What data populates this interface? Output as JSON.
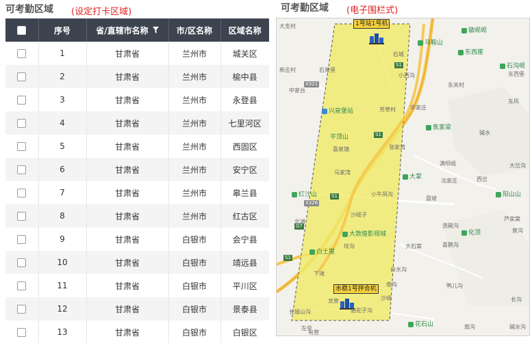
{
  "left_panel": {
    "title": "可考勤区域",
    "note": "(设定打卡区域)",
    "columns": {
      "index": "序号",
      "province": "省/直辖市名称",
      "city": "市/区名称",
      "region": "区域名称"
    },
    "rows": [
      {
        "index": "1",
        "province": "甘肃省",
        "city": "兰州市",
        "region": "城关区"
      },
      {
        "index": "2",
        "province": "甘肃省",
        "city": "兰州市",
        "region": "榆中县"
      },
      {
        "index": "3",
        "province": "甘肃省",
        "city": "兰州市",
        "region": "永登县"
      },
      {
        "index": "4",
        "province": "甘肃省",
        "city": "兰州市",
        "region": "七里河区"
      },
      {
        "index": "5",
        "province": "甘肃省",
        "city": "兰州市",
        "region": "西固区"
      },
      {
        "index": "6",
        "province": "甘肃省",
        "city": "兰州市",
        "region": "安宁区"
      },
      {
        "index": "7",
        "province": "甘肃省",
        "city": "兰州市",
        "region": "皋兰县"
      },
      {
        "index": "8",
        "province": "甘肃省",
        "city": "兰州市",
        "region": "红古区"
      },
      {
        "index": "9",
        "province": "甘肃省",
        "city": "白银市",
        "region": "会宁县"
      },
      {
        "index": "10",
        "province": "甘肃省",
        "city": "白银市",
        "region": "靖远县"
      },
      {
        "index": "11",
        "province": "甘肃省",
        "city": "白银市",
        "region": "平川区"
      },
      {
        "index": "12",
        "province": "甘肃省",
        "city": "白银市",
        "region": "景泰县"
      },
      {
        "index": "13",
        "province": "甘肃省",
        "city": "白银市",
        "region": "白银区"
      }
    ]
  },
  "right_panel": {
    "title": "可考勤区域",
    "note": "(电子围栏式)",
    "stations": {
      "top": "1号站1号机",
      "bottom": "水稳1号拌合机"
    },
    "place_labels": [
      "大支村",
      "石城",
      "新庄村",
      "石泉堡",
      "中家台",
      "兴泉堡站",
      "华家庄",
      "平顶山",
      "喜泉镇",
      "马家湾",
      "张家湾",
      "红沙山",
      "小牛凤沟",
      "沙岘子",
      "北滩",
      "大敦煌影视城",
      "白土崖",
      "坟沟",
      "下滩",
      "大石窝",
      "白水沟",
      "南沟",
      "龙泉",
      "骆驼子沟",
      "长城山沟",
      "左垒",
      "有营",
      "东西堡",
      "东关村",
      "东风",
      "碱水",
      "满坝岘",
      "沈家庄",
      "西岔",
      "大岔沟",
      "盘坡",
      "洗碗沟",
      "喜鹊沟",
      "芦家窝",
      "泉沟",
      "鸭儿沟",
      "南沟",
      "长沟",
      "碱水沟",
      "沙岘",
      "小西沟",
      "芳草村"
    ],
    "pois": [
      "徽岘岘",
      "马鞍山",
      "东西崖",
      "石沟岘",
      "焦家梁",
      "大掌",
      "阳山山",
      "化顶",
      "花石山"
    ],
    "road_badges": [
      "S1",
      "X321",
      "S1",
      "S1",
      "X326",
      "S1",
      "G7"
    ]
  },
  "colors": {
    "header_bg": "#3d4450",
    "note_red": "#e02020",
    "fence_fill": "#f0ea6a",
    "poi_green": "#3ea55b"
  }
}
